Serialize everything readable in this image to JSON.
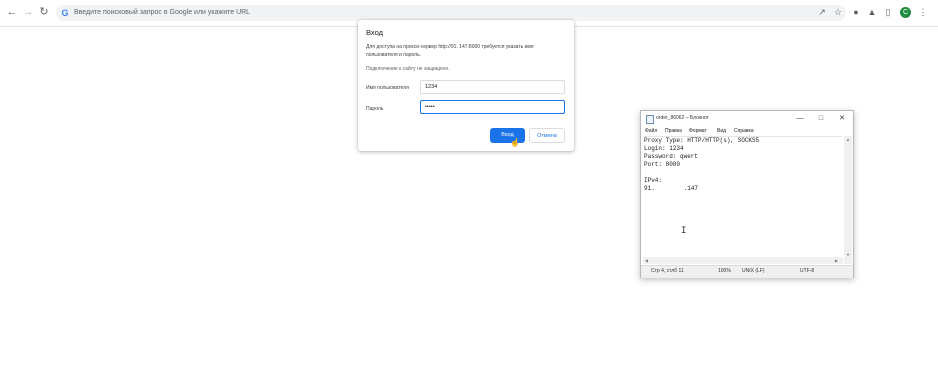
{
  "browser": {
    "omnibox_placeholder": "Введите поисковый запрос в Google или укажите URL",
    "profile_initial": "C",
    "accent_color": "#1a73e8"
  },
  "dialog": {
    "title": "Вход",
    "description": "Для доступа на прокси-сервер http://91.          147:8000 требуется указать имя пользователя и пароль.",
    "warning": "Подключение к сайту не защищено.",
    "username_label": "Имя пользователя",
    "username_value": "1234",
    "password_label": "Пароль",
    "password_value": "•••••",
    "submit_label": "Вход",
    "cancel_label": "Отмена"
  },
  "notepad": {
    "title": "order_86062 – Блокнот",
    "menu": [
      "Файл",
      "Правка",
      "Формат",
      "Вид",
      "Справка"
    ],
    "lines": [
      "Proxy Type: HTTP/HTTP(s), SOCKS5",
      "Login: 1234",
      "Password: qwert",
      "Port: 8000",
      "",
      "IPv4:",
      "91.        .147"
    ],
    "status": {
      "position": "Стр 4, стлб 11",
      "zoom": "100%",
      "line_endings": "UNIX (LF)",
      "encoding": "UTF-8"
    }
  }
}
